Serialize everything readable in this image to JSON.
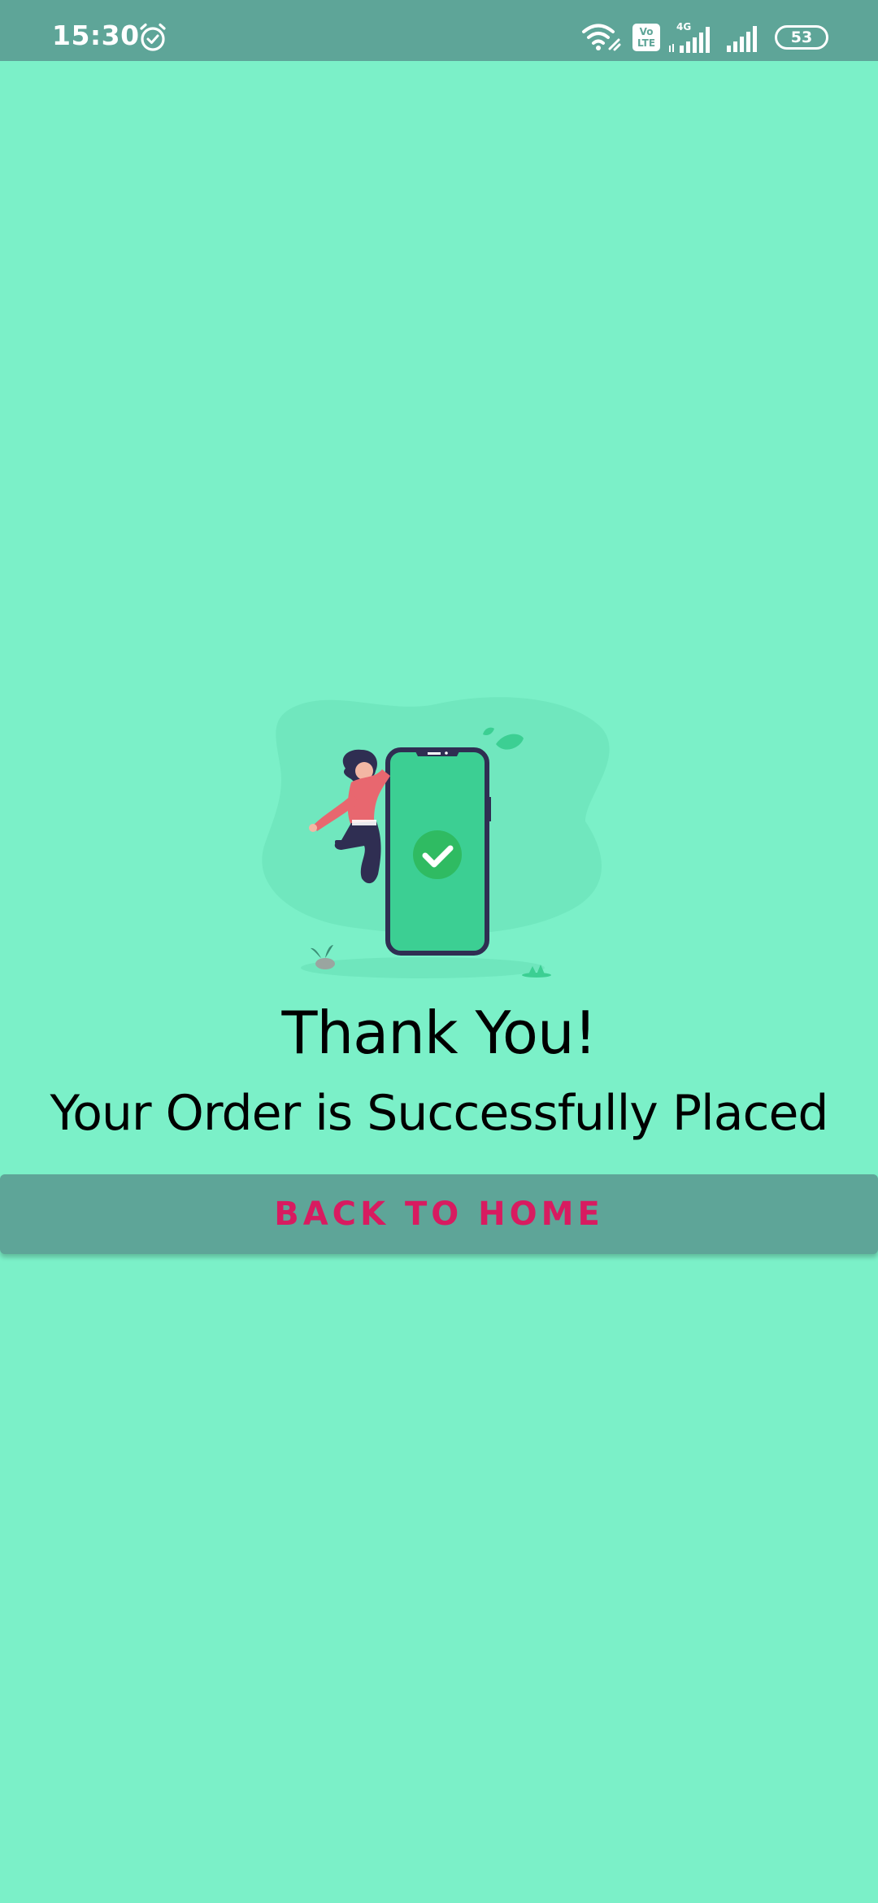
{
  "status_bar": {
    "time": "15:30",
    "volte_label": "Vo LTE",
    "network_type": "4G",
    "battery_level": "53",
    "background_color": "#5ea598"
  },
  "illustration": {
    "description_icon": "phone-checkmark-woman-jumping",
    "accent_color": "#3ccf93"
  },
  "main": {
    "heading": "Thank You!",
    "subheading": "Your Order is Successfully Placed",
    "background_color": "#7bf0c8"
  },
  "actions": {
    "back_home_label": "BACK TO HOME",
    "button_text_color": "#d81b60",
    "button_background": "#5ea598"
  }
}
